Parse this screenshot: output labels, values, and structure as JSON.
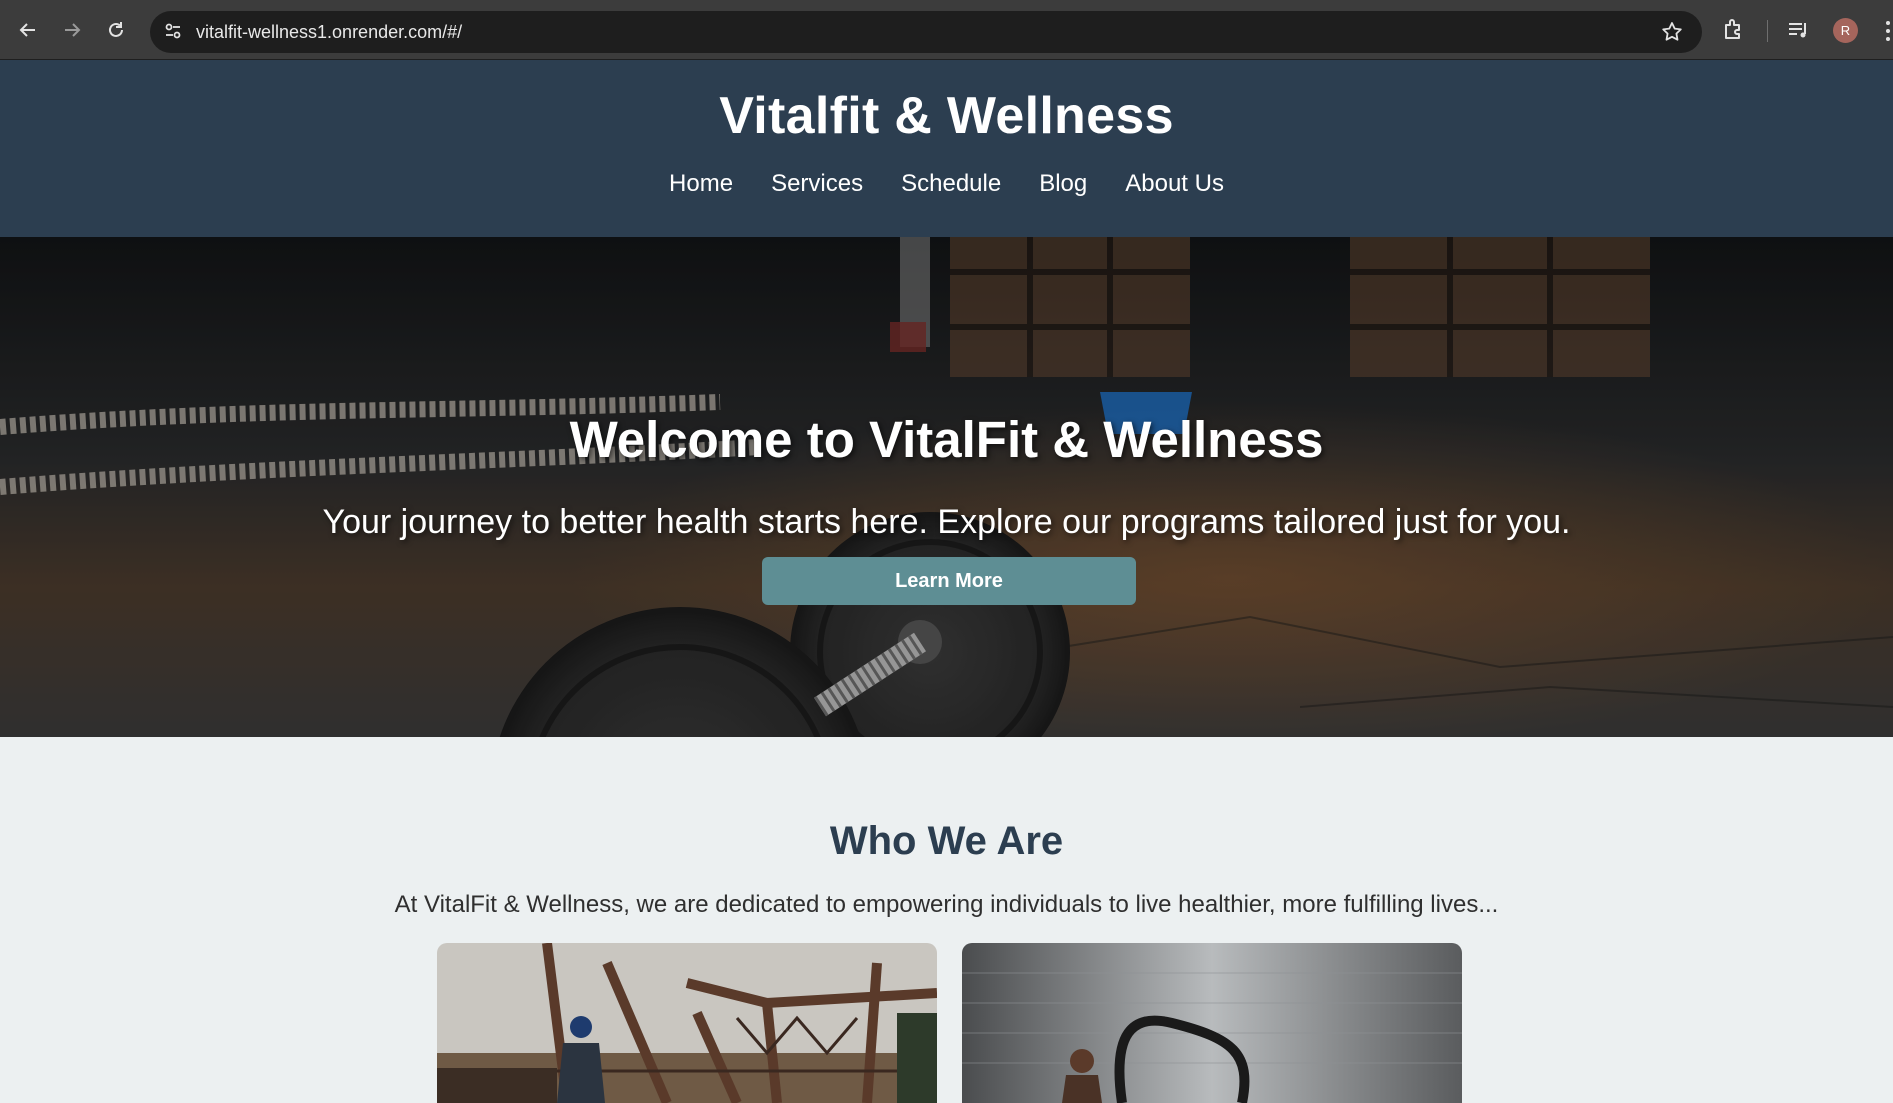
{
  "browser": {
    "url": "vitalfit-wellness1.onrender.com/#/",
    "avatar_initial": "R",
    "icons": [
      "back-arrow-icon",
      "forward-arrow-icon",
      "reload-icon",
      "site-info-icon",
      "star-icon",
      "extensions-icon",
      "media-control-icon",
      "more-menu-icon"
    ]
  },
  "header": {
    "title": "Vitalfit & Wellness",
    "nav": [
      "Home",
      "Services",
      "Schedule",
      "Blog",
      "About Us"
    ]
  },
  "hero": {
    "title": "Welcome to VitalFit & Wellness",
    "subtitle": "Your journey to better health starts here. Explore our programs tailored just for you.",
    "button_label": "Learn More"
  },
  "about": {
    "heading": "Who We Are",
    "text": "At VitalFit & Wellness, we are dedicated to empowering individuals to live healthier, more fulfilling lives..."
  },
  "colors": {
    "header_bg": "#2c3e50",
    "button_bg": "#5e8e94",
    "page_bg": "#ecf0f1"
  }
}
